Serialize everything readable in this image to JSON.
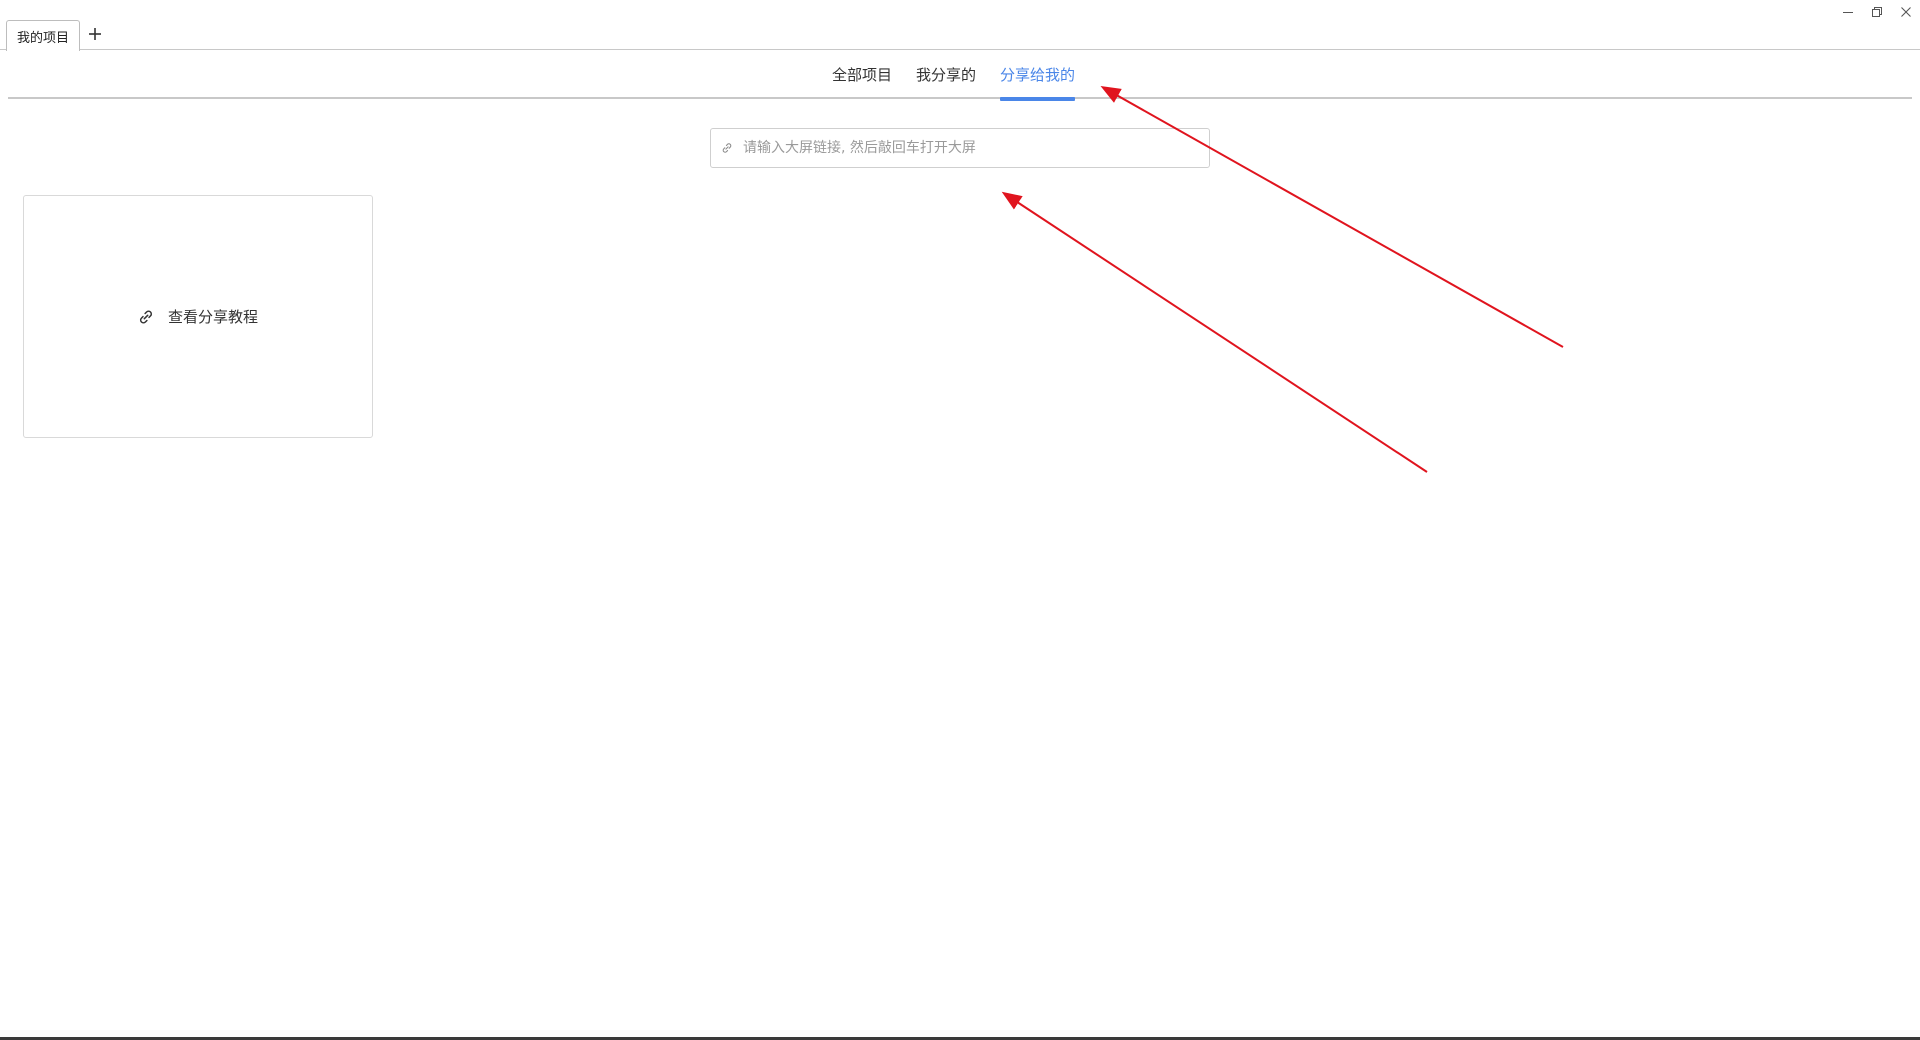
{
  "titlebar": {
    "tab_label": "我的项目",
    "add_tab_symbol": "+",
    "window_controls": [
      "minimize-icon",
      "restore-icon",
      "close-icon"
    ]
  },
  "nav": {
    "tabs": [
      {
        "label": "全部项目",
        "active": false
      },
      {
        "label": "我分享的",
        "active": false
      },
      {
        "label": "分享给我的",
        "active": true
      }
    ],
    "active_color": "#4a86e8"
  },
  "link_input": {
    "placeholder": "请输入大屏链接, 然后敲回车打开大屏",
    "value": "",
    "icon": "link-icon"
  },
  "card": {
    "label": "查看分享教程",
    "icon": "link-icon"
  },
  "annotations": {
    "arrow_color": "#e0141e",
    "count": 2
  }
}
